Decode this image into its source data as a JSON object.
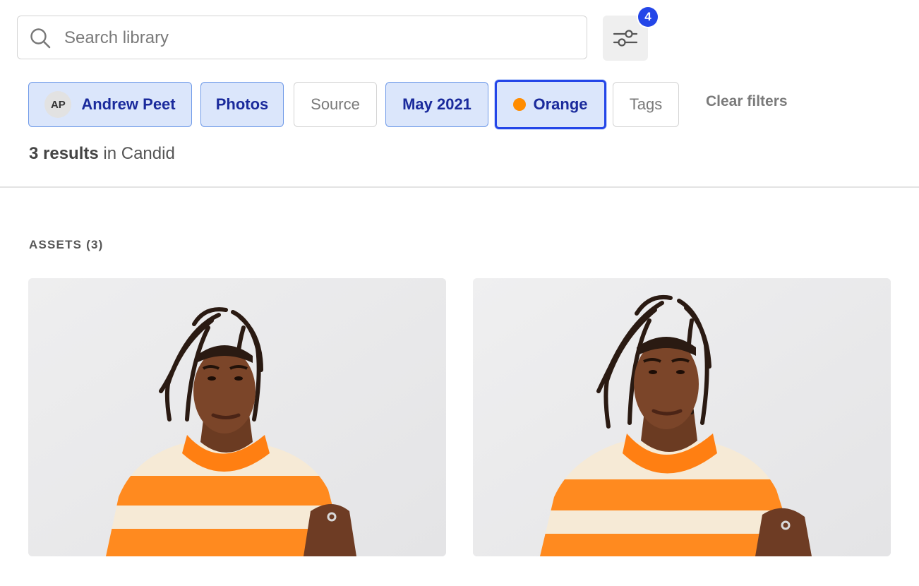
{
  "search": {
    "placeholder": "Search library",
    "icon": "search-icon"
  },
  "filter_button": {
    "icon": "sliders-icon",
    "badge_count": "4",
    "badge_color": "#2446e8"
  },
  "filters": {
    "creator": {
      "initials": "AP",
      "label": "Andrew Peet"
    },
    "type": {
      "label": "Photos"
    },
    "source": {
      "label": "Source"
    },
    "date": {
      "label": "May 2021"
    },
    "color": {
      "label": "Orange",
      "swatch": "#ff8c00"
    },
    "tags": {
      "label": "Tags"
    },
    "clear_label": "Clear filters"
  },
  "results": {
    "count": "3 results",
    "suffix": "in Candid"
  },
  "assets": {
    "section_title": "ASSETS (3)",
    "items": [
      {
        "kind": "photo"
      },
      {
        "kind": "photo"
      }
    ]
  },
  "colors": {
    "accent": "#2446e8",
    "chip_active_bg": "#dbe6fb",
    "chip_active_text": "#1a2a9c",
    "sweater_orange": "#ff8c00"
  }
}
